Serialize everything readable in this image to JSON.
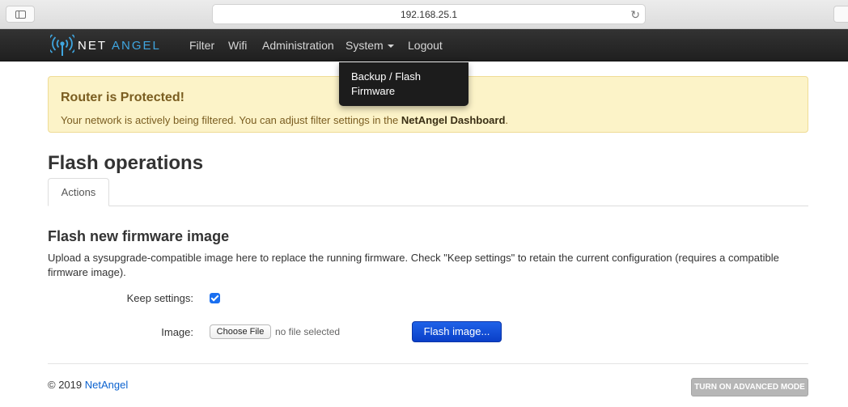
{
  "browser": {
    "url": "192.168.25.1",
    "icons": {
      "sidebar": "sidebar-icon",
      "reload": "reload-icon"
    }
  },
  "navbar": {
    "brand_net": "NET",
    "brand_angel": "ANGEL",
    "brand_icon": "wifi-signal-icon",
    "items": [
      "Filter",
      "Wifi",
      "Administration",
      "System",
      "Logout"
    ]
  },
  "dropdown": {
    "item": "Backup / Flash Firmware"
  },
  "alert": {
    "title": "Router is Protected!",
    "text": "Your network is actively being filtered. You can adjust filter settings in the",
    "link_text": "NetAngel Dashboard",
    "text_end": "."
  },
  "page": {
    "title": "Flash operations",
    "tab": "Actions"
  },
  "section": {
    "title": "Flash new firmware image",
    "description": "Upload a sysupgrade-compatible image here to replace the running firmware. Check \"Keep settings\" to retain the current configuration (requires a compatible firmware image).",
    "keep_settings_label": "Keep settings:",
    "keep_settings_checked": true,
    "image_label": "Image:",
    "choose_file_label": "Choose File",
    "no_file_text": "no file selected",
    "flash_button": "Flash image..."
  },
  "footer": {
    "copyright": "© 2019",
    "link": "NetAngel",
    "advanced_button": "TURN ON ADVANCED MODE"
  },
  "colors": {
    "navbar": "#2a2a2a",
    "brand_accent": "#3fa6e0",
    "alert_bg": "#fcf3c8",
    "primary_button": "#1450dc",
    "link": "#0b62cf"
  }
}
